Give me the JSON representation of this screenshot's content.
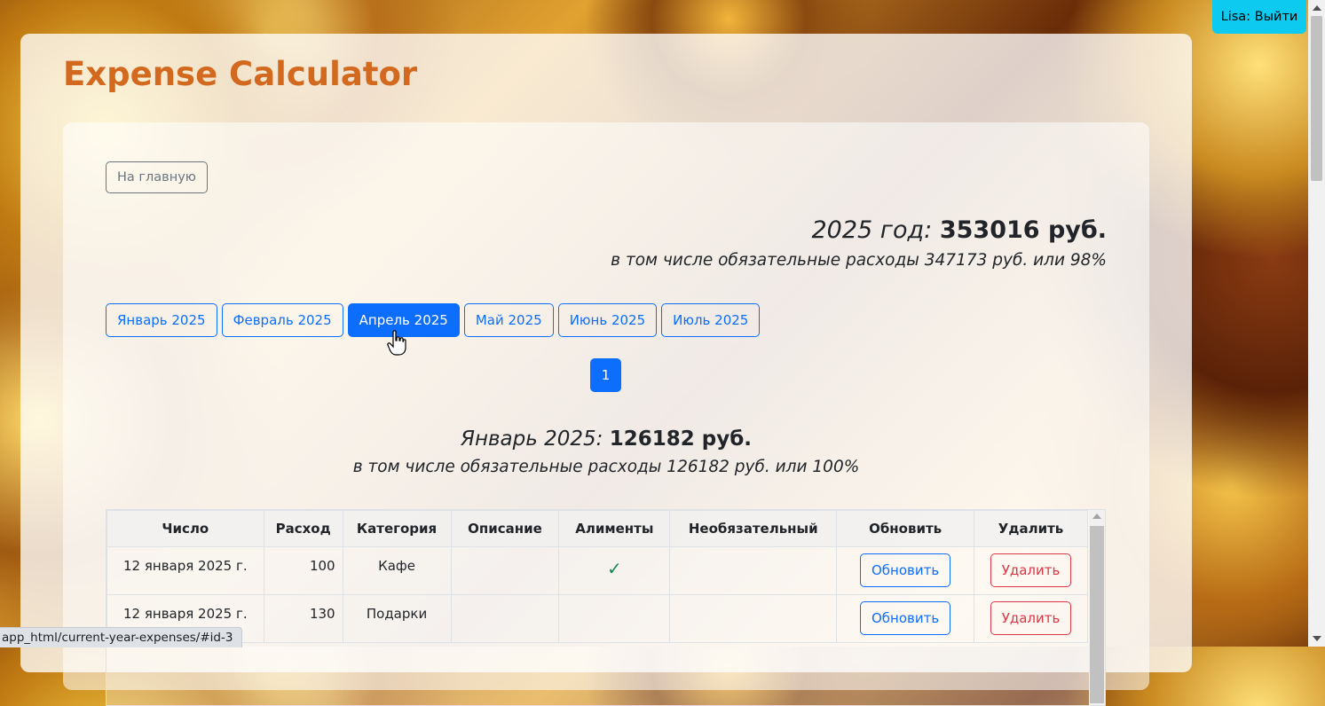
{
  "app": {
    "title": "Expense Calculator"
  },
  "user": {
    "logout_label": "Lisa: Выйти"
  },
  "nav": {
    "home_label": "На главную"
  },
  "year_summary": {
    "label": "2025 год:",
    "total": "353016 руб.",
    "mandatory_text": "в том числе обязательные расходы 347173 руб. или 98%"
  },
  "months": [
    {
      "label": "Январь 2025",
      "active": false
    },
    {
      "label": "Февраль 2025",
      "active": false
    },
    {
      "label": "Апрель 2025",
      "active": true
    },
    {
      "label": "Май 2025",
      "active": false
    },
    {
      "label": "Июнь 2025",
      "active": false
    },
    {
      "label": "Июль 2025",
      "active": false
    }
  ],
  "pagination": {
    "current_page": "1"
  },
  "month_summary": {
    "label": "Январь 2025:",
    "total": "126182 руб.",
    "mandatory_text": "в том числе обязательные расходы 126182 руб. или 100%"
  },
  "table": {
    "headers": [
      "Число",
      "Расход",
      "Категория",
      "Описание",
      "Алименты",
      "Необязательный",
      "Обновить",
      "Удалить"
    ],
    "rows": [
      {
        "date": "12 января 2025 г.",
        "amount": "100",
        "category": "Кафе",
        "description": "",
        "alimony": true,
        "optional": "",
        "update_label": "Обновить",
        "delete_label": "Удалить"
      },
      {
        "date": "12 января 2025 г.",
        "amount": "130",
        "category": "Подарки",
        "description": "",
        "alimony": false,
        "optional": "",
        "update_label": "Обновить",
        "delete_label": "Удалить"
      }
    ]
  },
  "icons": {
    "alimony_check": "check-icon"
  },
  "status_bar": {
    "url": "app_html/current-year-expenses/#id-3"
  },
  "colors": {
    "accent": "#0d6efd",
    "title": "#d2691e",
    "danger": "#dc3545",
    "success": "#198754",
    "info": "#0dcaf0"
  }
}
